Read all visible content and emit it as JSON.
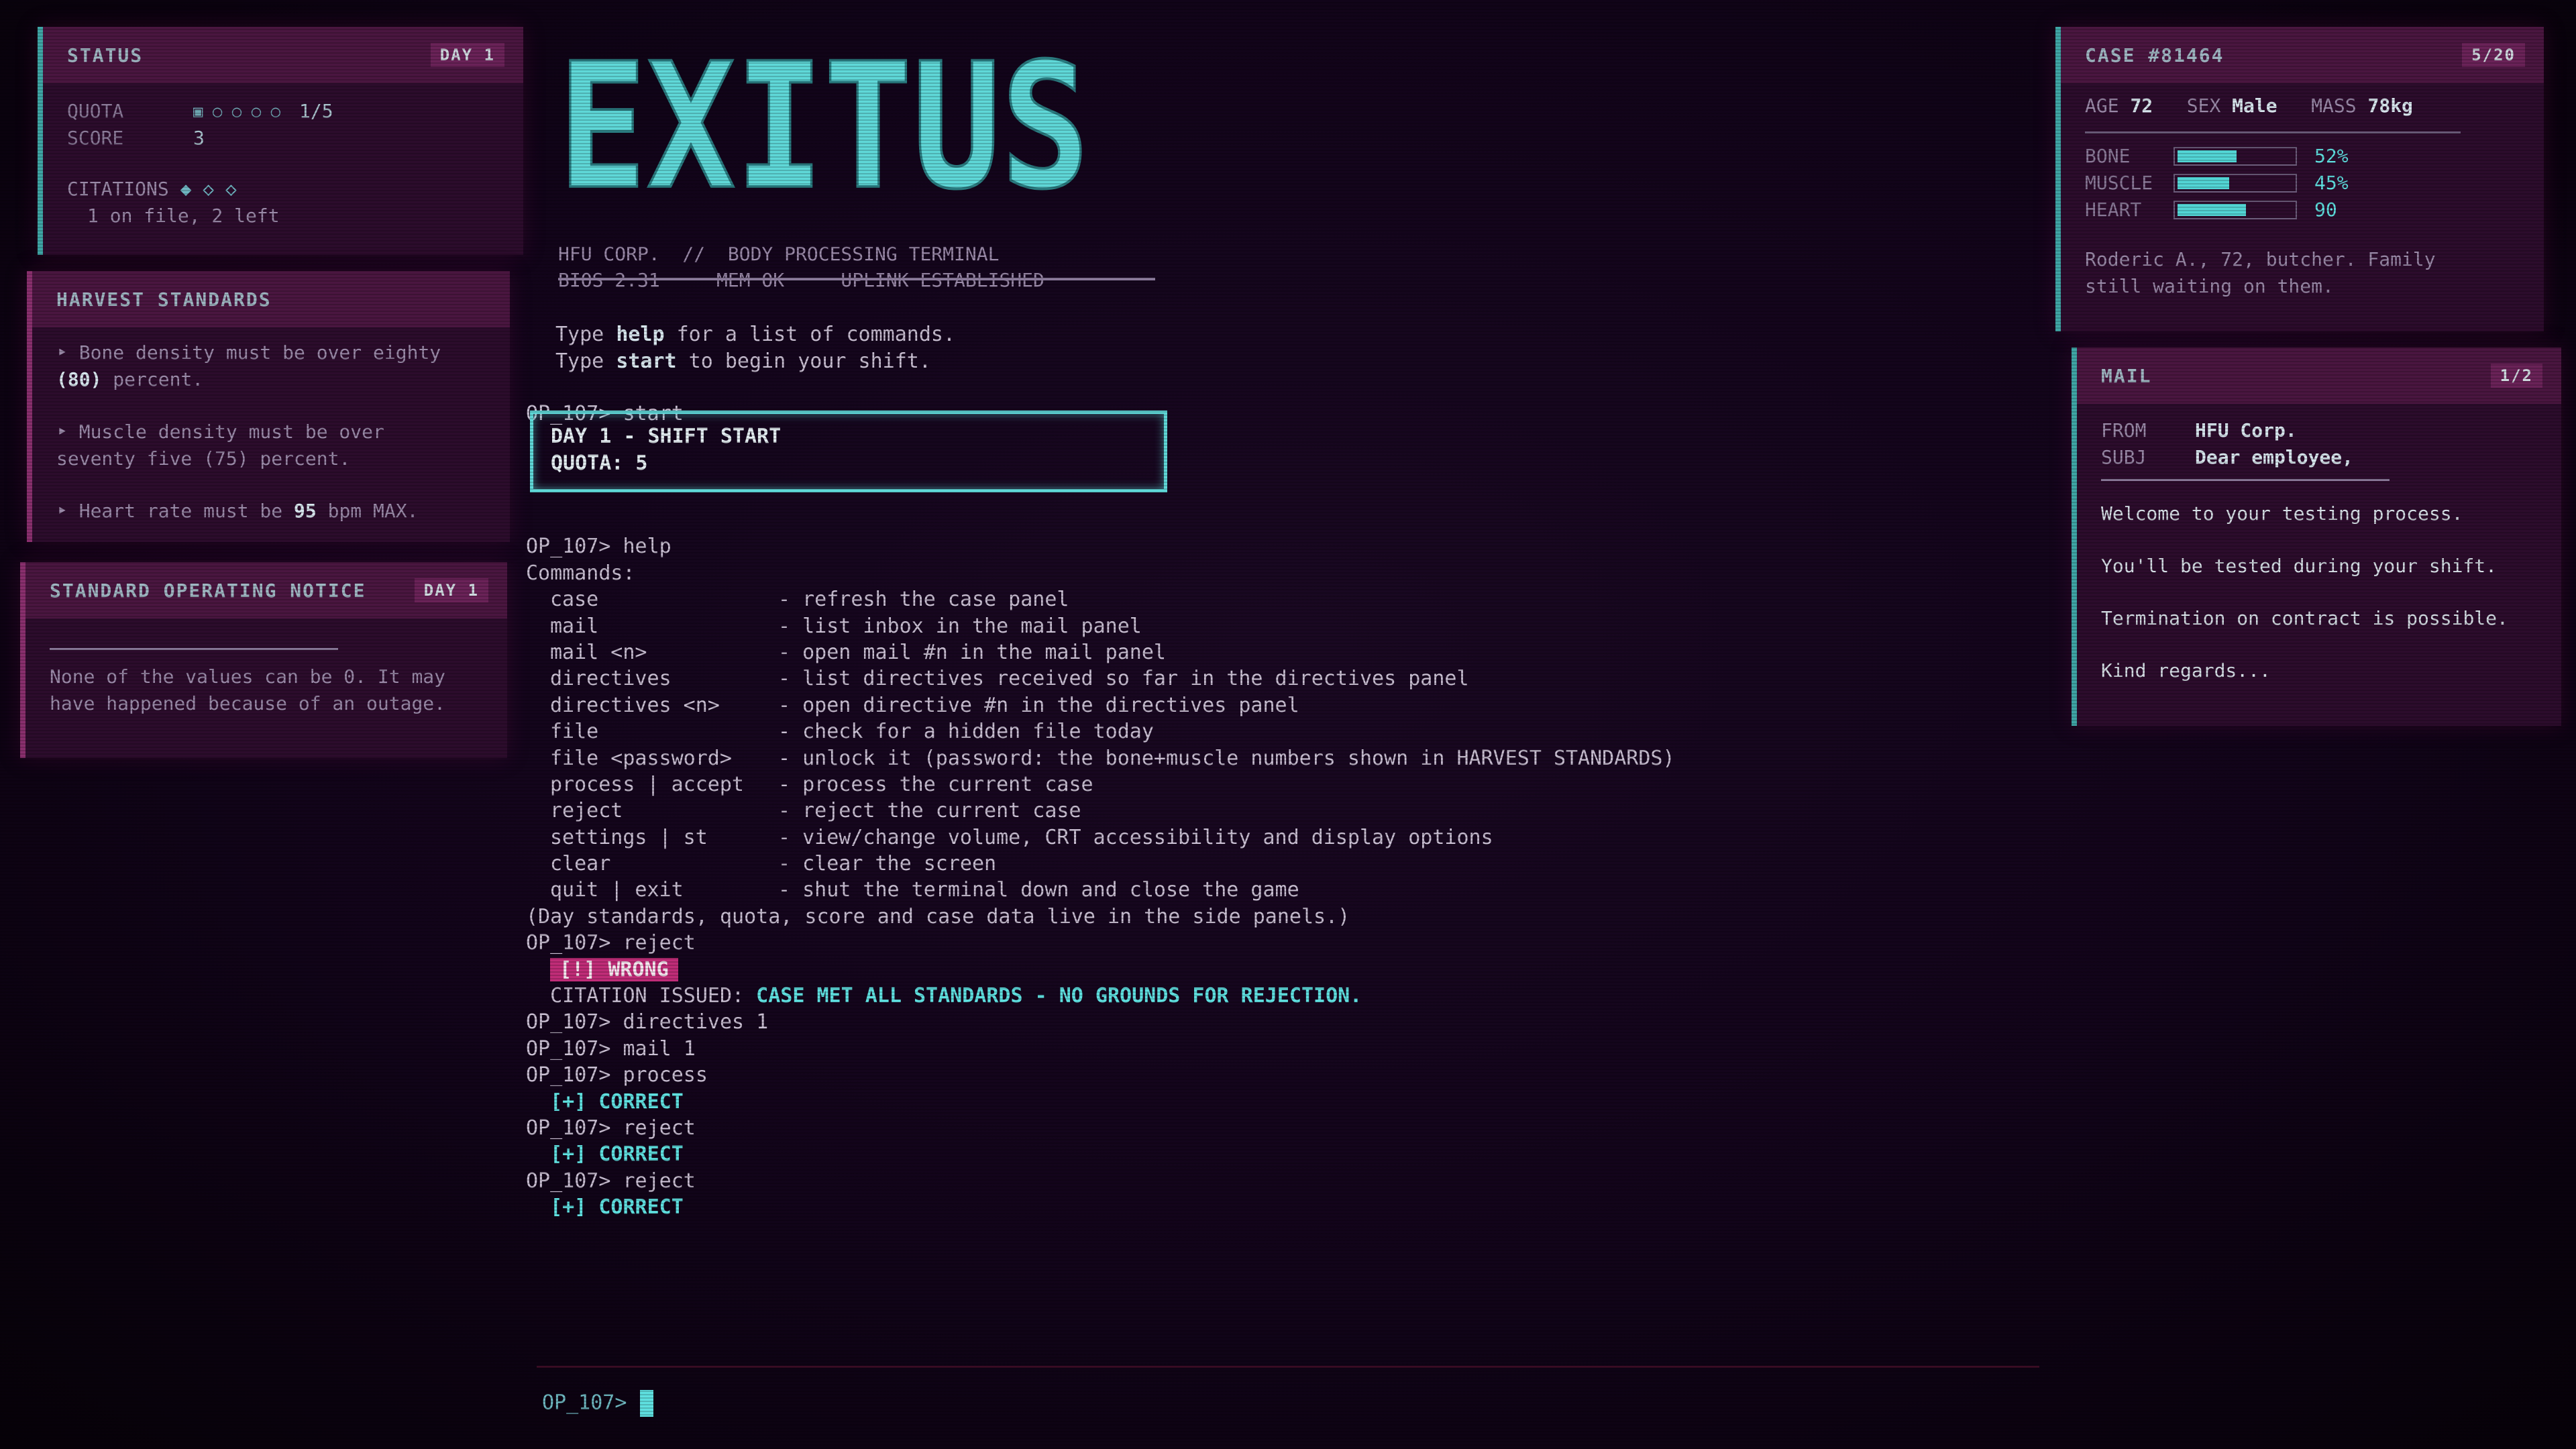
{
  "status": {
    "title": "STATUS",
    "day_badge": "DAY 1",
    "quota_label": "QUOTA",
    "quota_marks": "▣ ○ ○ ○ ○",
    "quota_value": "1/5",
    "score_label": "SCORE",
    "score_value": "3",
    "citations_label": "CITATIONS",
    "citations_marks": "◆ ◇ ◇",
    "citations_text": "1 on file, 2 left"
  },
  "harvest": {
    "title": "HARVEST STANDARDS",
    "rules": [
      {
        "pre": "‣ Bone density must be over eighty",
        "post": " percent.",
        "bold": "(80)"
      },
      {
        "pre": "‣ Muscle density must be over",
        "post": " percent.",
        "bold": "seventy five (75)"
      },
      {
        "pre": "‣ Heart rate must be ",
        "post": " bpm MAX.",
        "bold": "95"
      }
    ]
  },
  "notice": {
    "title": "STANDARD OPERATING NOTICE",
    "day_badge": "DAY 1",
    "text1": "None of the values can be 0. It may",
    "text2": "have happened because of an outage."
  },
  "case": {
    "title": "CASE #81464",
    "counter": "5/20",
    "age_label": "AGE",
    "age": "72",
    "sex_label": "SEX",
    "sex": "Male",
    "mass_label": "MASS",
    "mass": "78kg",
    "bone_label": "BONE",
    "bone": "52%",
    "bone_frac": 0.52,
    "muscle_label": "MUSCLE",
    "muscle": "45%",
    "muscle_frac": 0.45,
    "heart_label": "HEART",
    "heart": "90",
    "heart_frac": 0.6,
    "note1": "Roderic A., 72, butcher. Family",
    "note2": "still waiting on them."
  },
  "mail": {
    "title": "MAIL",
    "counter": "1/2",
    "from_label": "FROM",
    "from": "HFU Corp.",
    "subj_label": "SUBJ",
    "subj": "Dear employee,",
    "lines": [
      "Welcome to your testing process.",
      "You'll be tested during your shift.",
      "Termination on contract is possible.",
      "Kind regards..."
    ]
  },
  "terminal": {
    "logo": "EXITUS",
    "header1": "HFU CORP.  //  BODY PROCESSING TERMINAL",
    "header2": "BIOS 2.31     MEM OK     UPLINK ESTABLISHED",
    "intro_type": "Type ",
    "intro_help": "help",
    "intro_help_tail": " for a list of commands.",
    "intro_start": "start",
    "intro_start_tail": " to begin your shift.",
    "prompt": "OP_107>",
    "cmd_start": "start",
    "shift_line1": "DAY 1  -  SHIFT START",
    "shift_line2": "QUOTA: 5",
    "cmd_help": "help",
    "commands_header": "Commands:",
    "commands": [
      {
        "cmd": "case",
        "desc": "- refresh the case panel"
      },
      {
        "cmd": "mail",
        "desc": "- list inbox in the mail panel"
      },
      {
        "cmd": "mail <n>",
        "desc": "- open mail #n in the mail panel"
      },
      {
        "cmd": "directives",
        "desc": "- list directives received so far in the directives panel"
      },
      {
        "cmd": "directives <n>",
        "desc": "- open directive #n in the directives panel"
      },
      {
        "cmd": "file",
        "desc": "- check for a hidden file today"
      },
      {
        "cmd": "file <password>",
        "desc": "- unlock it (password: the bone+muscle numbers shown in HARVEST STANDARDS)"
      },
      {
        "cmd": "process | accept",
        "desc": "- process the current case"
      },
      {
        "cmd": "reject",
        "desc": "- reject the current case"
      },
      {
        "cmd": "settings | st",
        "desc": "- view/change volume, CRT accessibility and display options"
      },
      {
        "cmd": "clear",
        "desc": "- clear the screen"
      },
      {
        "cmd": "quit | exit",
        "desc": "- shut the terminal down and close the game"
      }
    ],
    "footnote": "(Day standards, quota, score and case data live in the side panels.)",
    "cmd_reject": "reject",
    "wrong": "[!] WRONG",
    "citation_label": "CITATION ISSUED:",
    "citation_text": "CASE MET ALL STANDARDS - NO GROUNDS FOR REJECTION.",
    "cmd_directives": "directives 1",
    "cmd_mail": "mail 1",
    "cmd_process": "process",
    "correct": "[+] CORRECT"
  },
  "input_prompt": "OP_107>"
}
